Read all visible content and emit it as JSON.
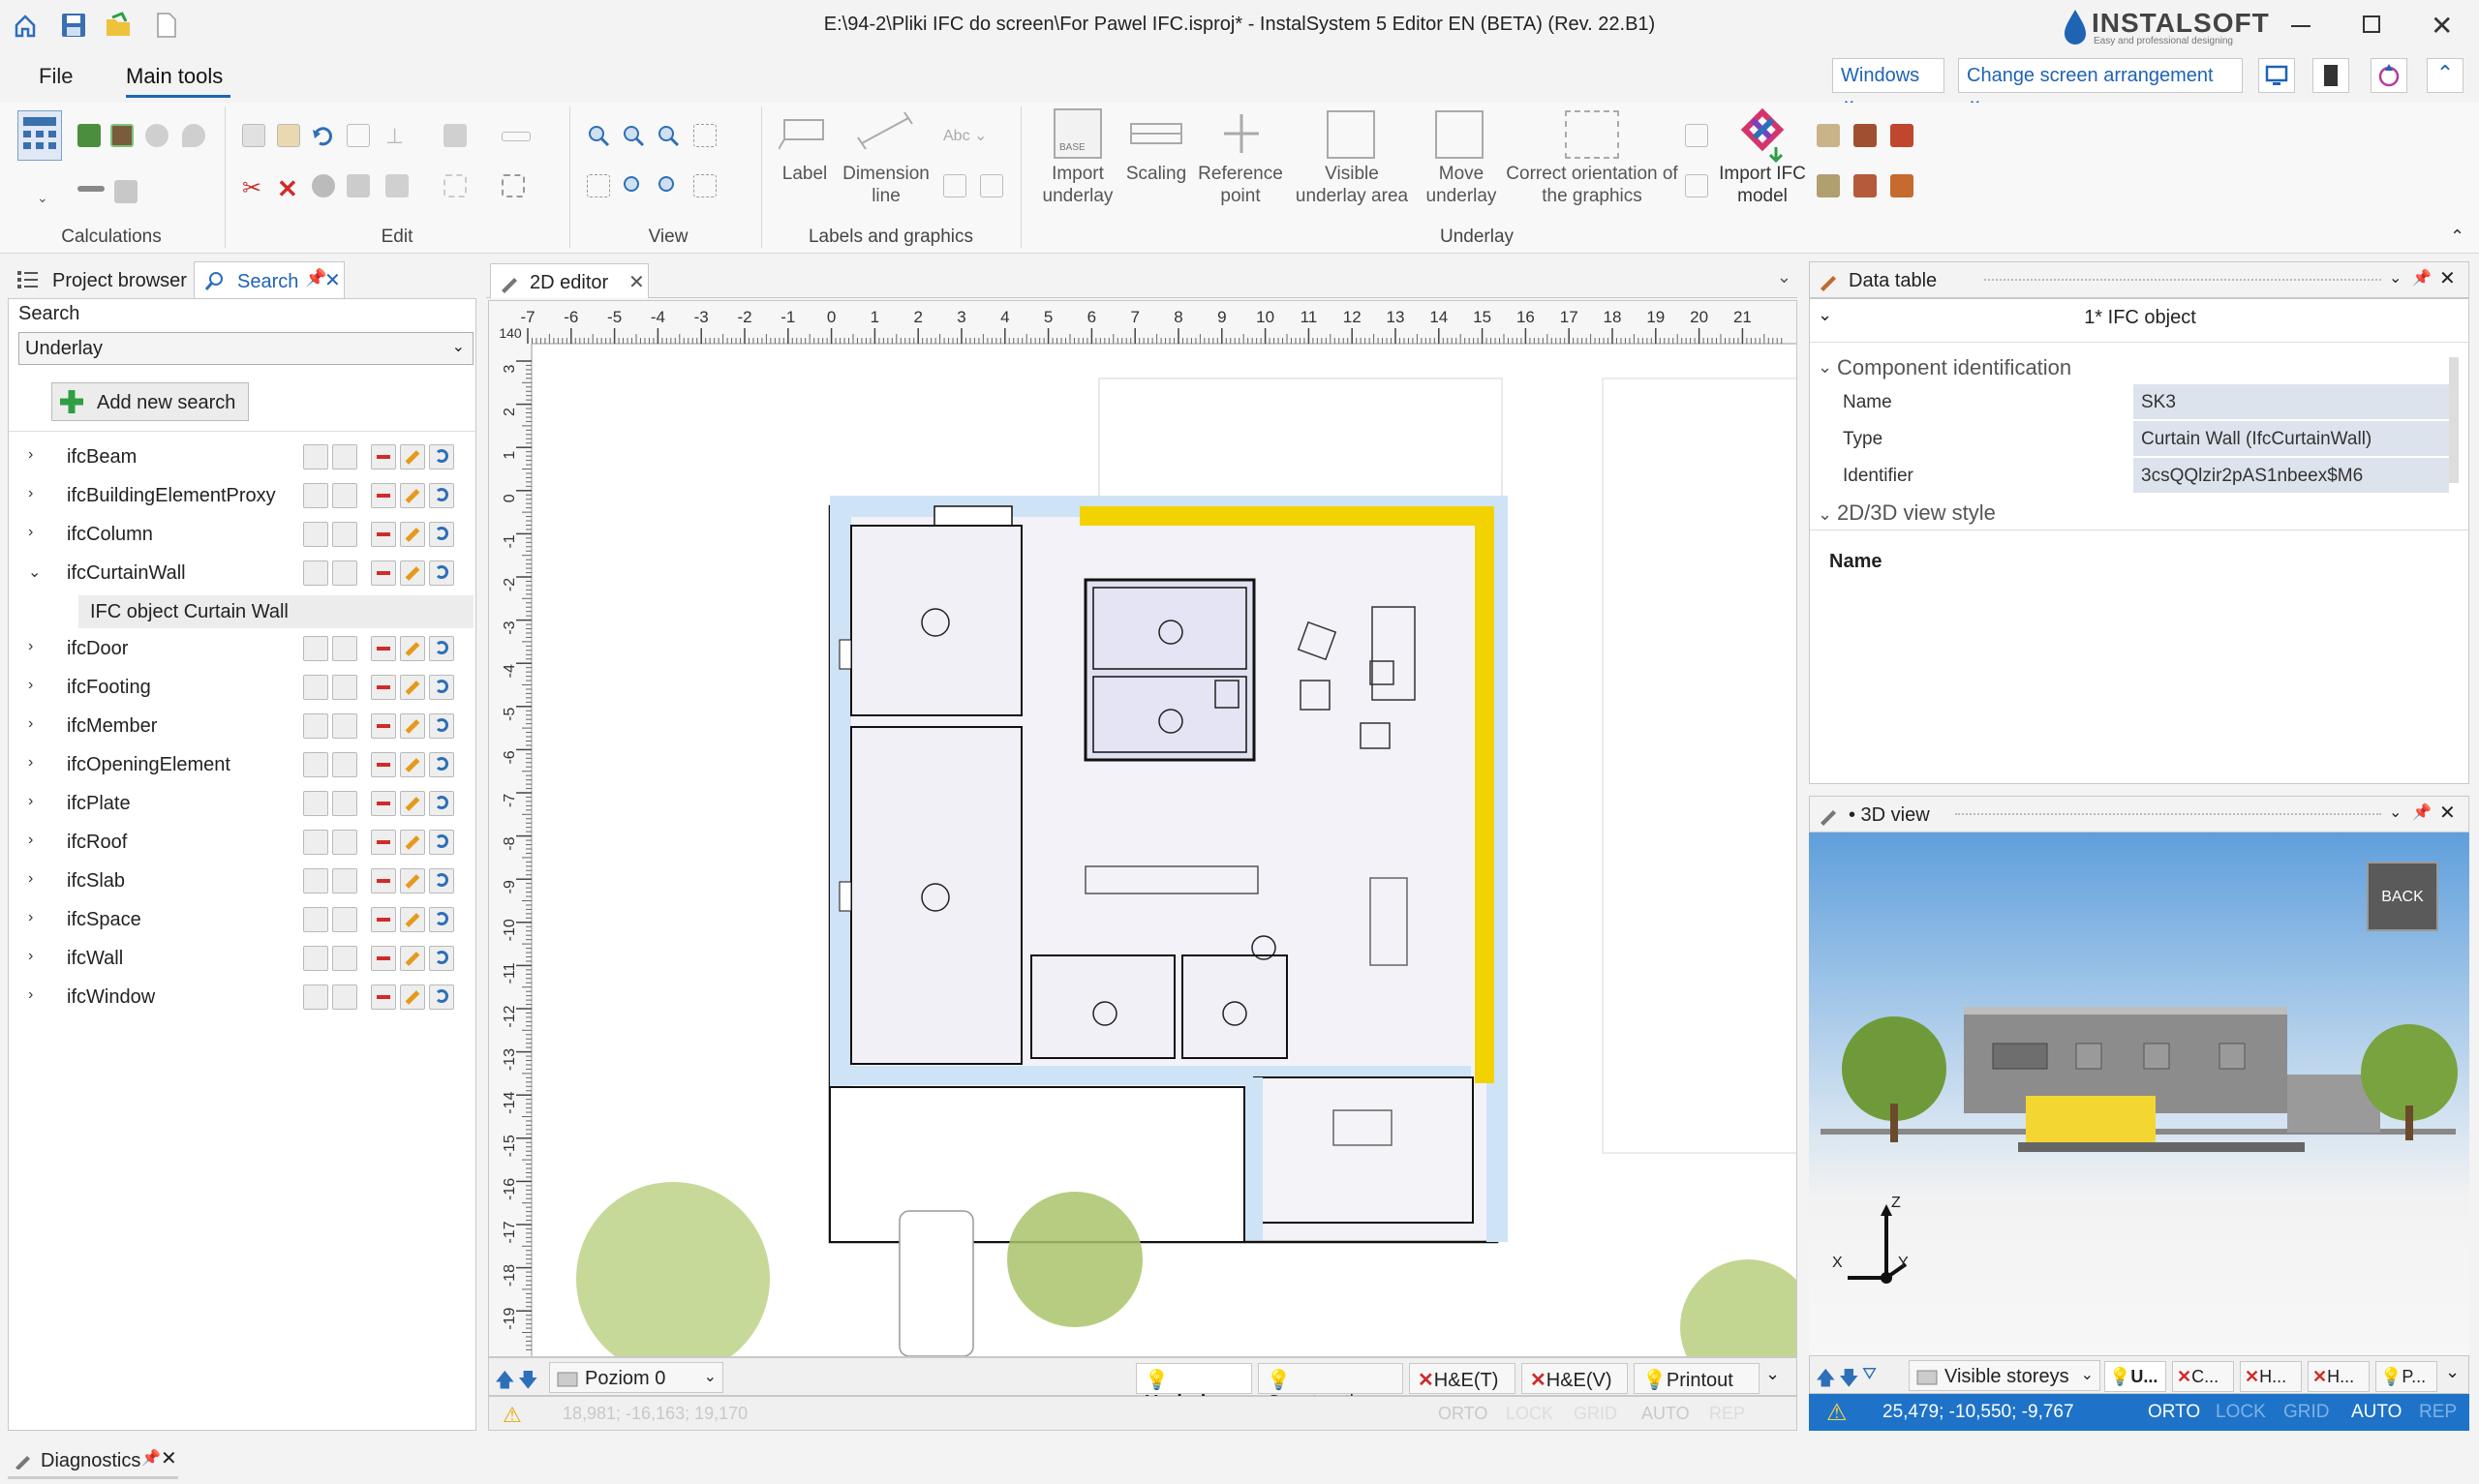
{
  "window": {
    "title": "E:\\94-2\\Pliki IFC do screen\\For Pawel IFC.isproj* - InstalSystem 5 Editor EN (BETA) (Rev. 22.B1)",
    "brand": "INSTALSOFT",
    "brand_tagline": "Easy and professional designing"
  },
  "menu": {
    "file": "File",
    "main_tools": "Main tools"
  },
  "top_right": {
    "windows": "Windows",
    "arrangement": "Change screen arrangement"
  },
  "ribbon": {
    "groups": {
      "calculations": "Calculations",
      "edit": "Edit",
      "view": "View",
      "labels": "Labels and graphics",
      "underlay": "Underlay"
    },
    "label_btn": "Label",
    "dimension_btn": "Dimension line",
    "abc": "Abc",
    "import_underlay": "Import underlay",
    "scaling": "Scaling",
    "reference_point": "Reference point",
    "visible_underlay_area": "Visible underlay area",
    "move_underlay": "Move underlay",
    "correct_orientation": "Correct orientation of the graphics",
    "import_ifc": "Import IFC model"
  },
  "left_panel": {
    "tab_project": "Project browser",
    "tab_search": "Search",
    "search_label": "Search",
    "search_value": "Underlay",
    "add_search": "Add new search",
    "items": [
      {
        "label": "ifcBeam",
        "expanded": false
      },
      {
        "label": "ifcBuildingElementProxy",
        "expanded": false
      },
      {
        "label": "ifcColumn",
        "expanded": false
      },
      {
        "label": "ifcCurtainWall",
        "expanded": true
      },
      {
        "label": "ifcDoor",
        "expanded": false
      },
      {
        "label": "ifcFooting",
        "expanded": false
      },
      {
        "label": "ifcMember",
        "expanded": false
      },
      {
        "label": "ifcOpeningElement",
        "expanded": false
      },
      {
        "label": "ifcPlate",
        "expanded": false
      },
      {
        "label": "ifcRoof",
        "expanded": false
      },
      {
        "label": "ifcSlab",
        "expanded": false
      },
      {
        "label": "ifcSpace",
        "expanded": false
      },
      {
        "label": "ifcWall",
        "expanded": false
      },
      {
        "label": "ifcWindow",
        "expanded": false
      }
    ],
    "child_item": "IFC object Curtain Wall"
  },
  "editor": {
    "tab": "2D editor",
    "ruler_corner": "140",
    "h_ruler": [
      "-7",
      "-6",
      "-5",
      "-4",
      "-3",
      "-2",
      "-1",
      "0",
      "1",
      "2",
      "3",
      "4",
      "5",
      "6",
      "7",
      "8",
      "9",
      "10",
      "11",
      "12",
      "13",
      "14",
      "15",
      "16",
      "17",
      "18",
      "19",
      "20",
      "21"
    ],
    "v_ruler": [
      "3",
      "2",
      "1",
      "0",
      "-1",
      "-2",
      "-3",
      "-4",
      "-5",
      "-6",
      "-7",
      "-8",
      "-9",
      "-10",
      "-11",
      "-12",
      "-13",
      "-14",
      "-15",
      "-16",
      "-17",
      "-18",
      "-19"
    ],
    "level": "Poziom 0",
    "bottom_tabs": [
      "Underlay",
      "Construction",
      "H&E(T)",
      "H&E(V)",
      "Printout"
    ],
    "coords": "18,981; -16,163; 19,170",
    "status_flags": [
      "ORTO",
      "LOCK",
      "GRID",
      "AUTO",
      "REP"
    ]
  },
  "data_table": {
    "title": "Data table",
    "object_count": "1* IFC object",
    "section_ident": "Component identification",
    "rows": [
      {
        "key": "Name",
        "value": "SK3"
      },
      {
        "key": "Type",
        "value": "Curtain Wall (IfcCurtainWall)"
      },
      {
        "key": "Identifier",
        "value": "3csQQlzir2pAS1nbeex$M6"
      }
    ],
    "section_style": "2D/3D view style",
    "footer_label": "Name"
  },
  "view3d": {
    "title": "• 3D view",
    "back": "BACK",
    "axis_z": "Z",
    "axis_x": "X",
    "axis_y": "Y",
    "storeys": "Visible storeys",
    "tabs": [
      "U...",
      "C...",
      "H...",
      "H...",
      "P..."
    ],
    "coords": "25,479; -10,550; -9,767",
    "status_flags": [
      "ORTO",
      "LOCK",
      "GRID",
      "AUTO",
      "REP"
    ]
  },
  "diagnostics": "Diagnostics",
  "colors": {
    "accent": "#1565c0",
    "curtain_wall": "#f2d200",
    "wall_fill": "#cfe3f7",
    "status_bar": "#1e73c8"
  }
}
